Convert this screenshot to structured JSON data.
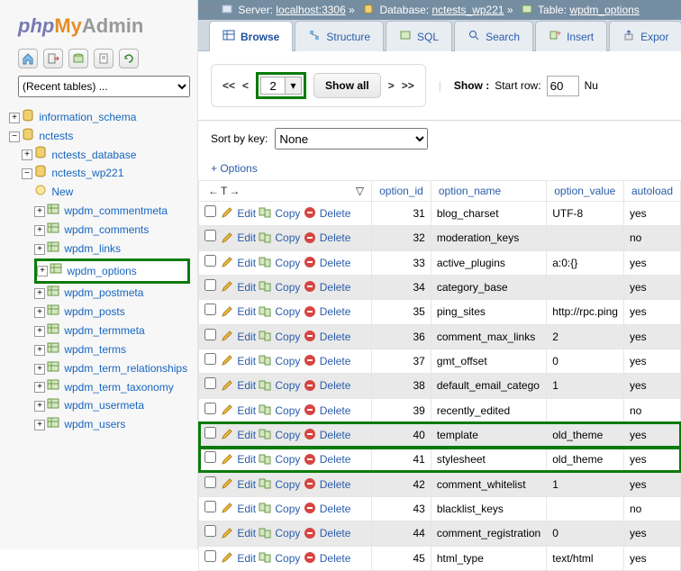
{
  "logo": {
    "php": "php",
    "my": "My",
    "admin": "Admin"
  },
  "recent_tables_label": "(Recent tables) ...",
  "tree": {
    "db1": "information_schema",
    "db2": "nctests",
    "t1": "nctests_database",
    "t2": "nctests_wp221",
    "new": "New",
    "tables": [
      "wpdm_commentmeta",
      "wpdm_comments",
      "wpdm_links",
      "wpdm_options",
      "wpdm_postmeta",
      "wpdm_posts",
      "wpdm_termmeta",
      "wpdm_terms",
      "wpdm_term_relationships",
      "wpdm_term_taxonomy",
      "wpdm_usermeta",
      "wpdm_users"
    ],
    "selected_table": "wpdm_options"
  },
  "breadcrumb": {
    "server_lbl": "Server:",
    "server": "localhost:3306",
    "db_lbl": "Database:",
    "db": "nctests_wp221",
    "table_lbl": "Table:",
    "table": "wpdm_options"
  },
  "tabs": {
    "browse": "Browse",
    "structure": "Structure",
    "sql": "SQL",
    "search": "Search",
    "insert": "Insert",
    "export": "Expor"
  },
  "nav": {
    "first": "<<",
    "prev": "<",
    "page": "2",
    "next": ">",
    "last": ">>",
    "show_all": "Show all",
    "show_lbl": "Show :",
    "start_row_lbl": "Start row:",
    "start_row": "60",
    "num": "Nu"
  },
  "sort": {
    "label": "Sort by key:",
    "value": "None"
  },
  "options": "+ Options",
  "columns": [
    "option_id",
    "option_name",
    "option_value",
    "autoload"
  ],
  "actions": {
    "edit": "Edit",
    "copy": "Copy",
    "delete": "Delete"
  },
  "rows": [
    {
      "id": 31,
      "name": "blog_charset",
      "value": "UTF-8",
      "autoload": "yes",
      "hl": false,
      "odd": false
    },
    {
      "id": 32,
      "name": "moderation_keys",
      "value": "",
      "autoload": "no",
      "hl": false,
      "odd": true
    },
    {
      "id": 33,
      "name": "active_plugins",
      "value": "a:0:{}",
      "autoload": "yes",
      "hl": false,
      "odd": false
    },
    {
      "id": 34,
      "name": "category_base",
      "value": "",
      "autoload": "yes",
      "hl": false,
      "odd": true
    },
    {
      "id": 35,
      "name": "ping_sites",
      "value": "http://rpc.ping",
      "autoload": "yes",
      "hl": false,
      "odd": false
    },
    {
      "id": 36,
      "name": "comment_max_links",
      "value": "2",
      "autoload": "yes",
      "hl": false,
      "odd": true
    },
    {
      "id": 37,
      "name": "gmt_offset",
      "value": "0",
      "autoload": "yes",
      "hl": false,
      "odd": false
    },
    {
      "id": 38,
      "name": "default_email_catego",
      "value": "1",
      "autoload": "yes",
      "hl": false,
      "odd": true
    },
    {
      "id": 39,
      "name": "recently_edited",
      "value": "",
      "autoload": "no",
      "hl": false,
      "odd": false
    },
    {
      "id": 40,
      "name": "template",
      "value": "old_theme",
      "autoload": "yes",
      "hl": true,
      "odd": true
    },
    {
      "id": 41,
      "name": "stylesheet",
      "value": "old_theme",
      "autoload": "yes",
      "hl": true,
      "odd": false
    },
    {
      "id": 42,
      "name": "comment_whitelist",
      "value": "1",
      "autoload": "yes",
      "hl": false,
      "odd": true
    },
    {
      "id": 43,
      "name": "blacklist_keys",
      "value": "",
      "autoload": "no",
      "hl": false,
      "odd": false
    },
    {
      "id": 44,
      "name": "comment_registration",
      "value": "0",
      "autoload": "yes",
      "hl": false,
      "odd": true
    },
    {
      "id": 45,
      "name": "html_type",
      "value": "text/html",
      "autoload": "yes",
      "hl": false,
      "odd": false
    }
  ]
}
